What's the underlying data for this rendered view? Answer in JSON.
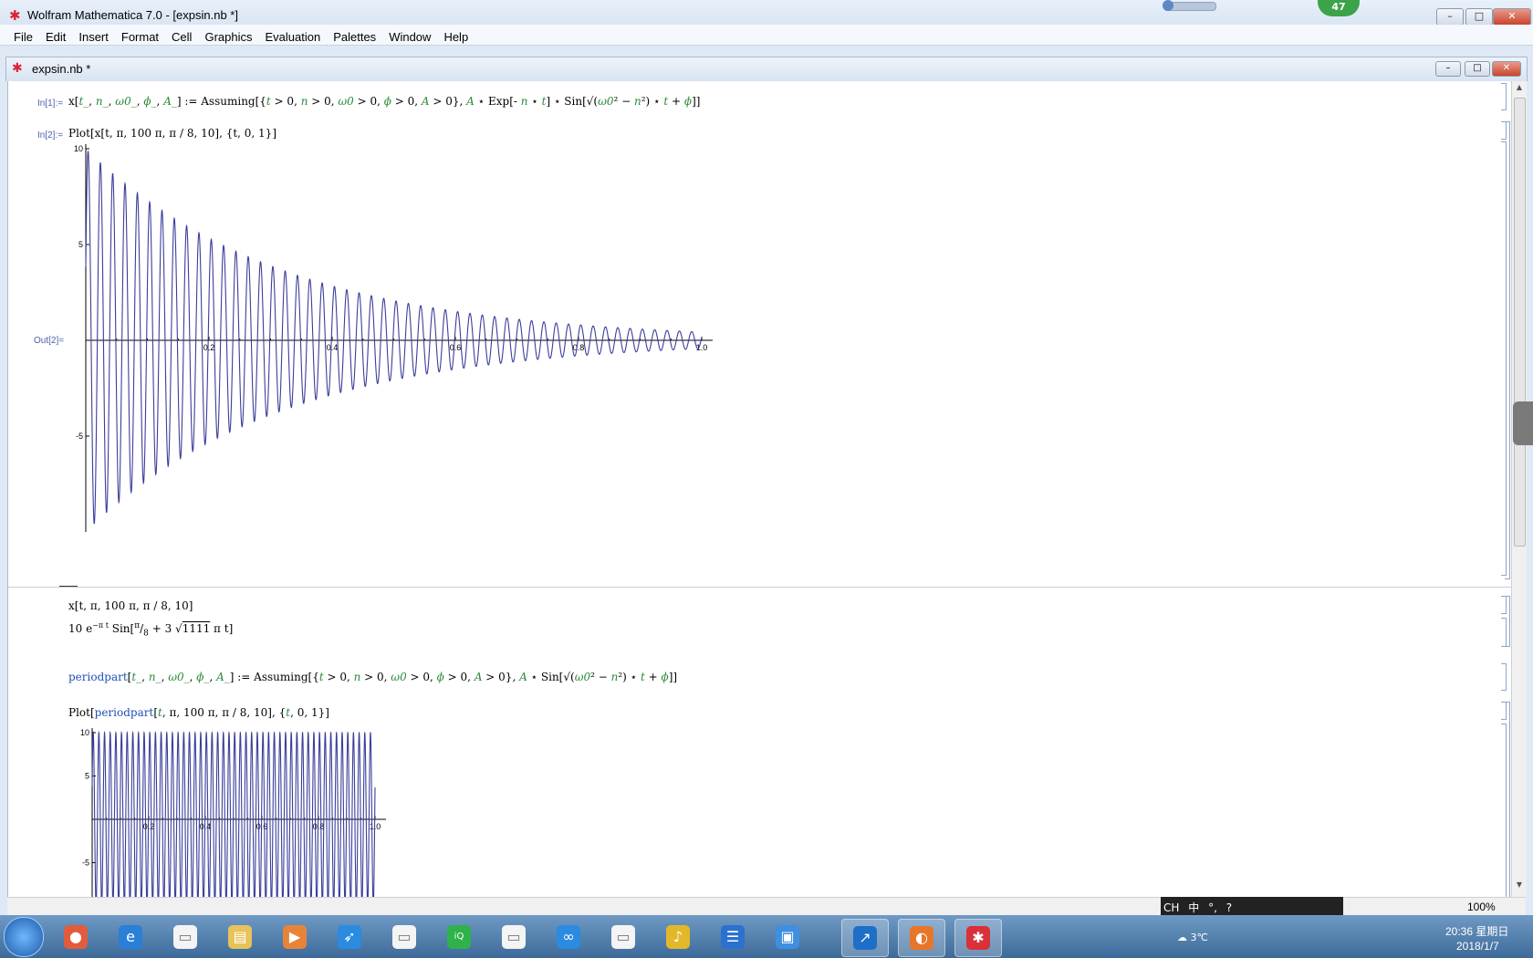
{
  "window": {
    "title": "Wolfram Mathematica 7.0 - [expsin.nb *]",
    "minimize": "–",
    "maximize": "□",
    "close": "✕",
    "badge": "47"
  },
  "menu": [
    "File",
    "Edit",
    "Insert",
    "Format",
    "Cell",
    "Graphics",
    "Evaluation",
    "Palettes",
    "Window",
    "Help"
  ],
  "notebook": {
    "title": "expsin.nb *",
    "cells": {
      "in1_label": "In[1]:=",
      "in2_label": "In[2]:=",
      "out2_label": "Out[2]=",
      "plot2_input": "Plot[x[t, π, 100 π, π / 8, 10], {t, 0, 1}]",
      "xinput": "x[t, π, 100 π, π / 8, 10]",
      "periodpart_plot_input": "Plot[periodpart[t, π, 100 π, π / 8, 10], {t, 0, 1}]"
    },
    "zoom": "100%"
  },
  "plot1": {
    "yticks": [
      "10",
      "5",
      "-5"
    ],
    "xticks": [
      "0.2",
      "0.4",
      "0.6",
      "0.8",
      "1.0"
    ]
  },
  "plot2": {
    "yticks": [
      "10",
      "5",
      "-5"
    ],
    "xticks": [
      "0.2",
      "0.4",
      "0.6",
      "0.8",
      "1.0"
    ]
  },
  "chart_data": [
    {
      "type": "line",
      "x": [
        0,
        0.2,
        0.4,
        0.6,
        0.8,
        1.0
      ],
      "ylim": [
        -10,
        10
      ],
      "xlim": [
        0,
        1
      ],
      "xticks": [
        "0.2",
        "0.4",
        "0.6",
        "0.8",
        "1.0"
      ],
      "yticks": [
        "10",
        "5",
        "-5"
      ],
      "series": [
        {
          "color": "#3a3e9a"
        }
      ]
    },
    {
      "type": "line",
      "xlim": [
        0,
        1
      ],
      "ylim": [
        -10,
        10
      ],
      "xticks": [
        "0.2",
        "0.4",
        "0.6",
        "0.8",
        "1.0"
      ],
      "yticks": [
        "10",
        "5",
        "-5"
      ],
      "series": [
        {
          "color": "#3a3e9a"
        }
      ]
    }
  ],
  "taskbar": {
    "weather": "3℃",
    "time": "20:36 星期日",
    "date": "2018/1/7",
    "ime": [
      "CH",
      "中",
      "°,",
      "?"
    ]
  }
}
